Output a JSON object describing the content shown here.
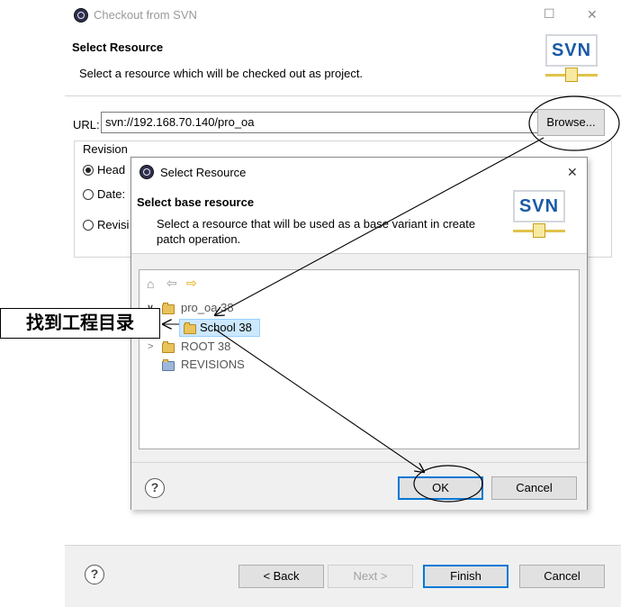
{
  "outer_window": {
    "title": "Checkout from SVN",
    "minimize_glyph": "☐",
    "close_glyph": "✕",
    "header_title": "Select Resource",
    "header_desc": "Select a resource which will be checked out as project.",
    "logo_text": "SVN",
    "url_label": "URL:",
    "url_value": "svn://192.168.70.140/pro_oa",
    "browse_label": "Browse...",
    "revision_legend": "Revision",
    "radio_head": "Head",
    "radio_date": "Date:",
    "radio_revision": "Revisi",
    "help_glyph": "?",
    "back_label": "< Back",
    "next_label": "Next >",
    "finish_label": "Finish",
    "cancel_label": "Cancel"
  },
  "inner_dialog": {
    "title": "Select Resource",
    "close_glyph": "✕",
    "header_title": "Select base resource",
    "header_desc": "Select a resource that will be used as a base variant in create patch operation.",
    "logo_text": "SVN",
    "toolbar": {
      "home_glyph": "⌂",
      "back_glyph": "⇦",
      "forward_glyph": "⇨"
    },
    "tree": [
      {
        "label": "pro_oa 38",
        "expanded": true
      },
      {
        "label": "School 38",
        "selected": true
      },
      {
        "label": "ROOT 38",
        "expanded": false
      },
      {
        "label": "REVISIONS"
      }
    ],
    "help_glyph": "?",
    "ok_label": "OK",
    "cancel_label": "Cancel"
  },
  "annotation": {
    "label": "找到工程目录"
  },
  "colors": {
    "accent": "#0078d7",
    "selection": "#cce8ff",
    "svn_blue": "#1a5aa6"
  }
}
